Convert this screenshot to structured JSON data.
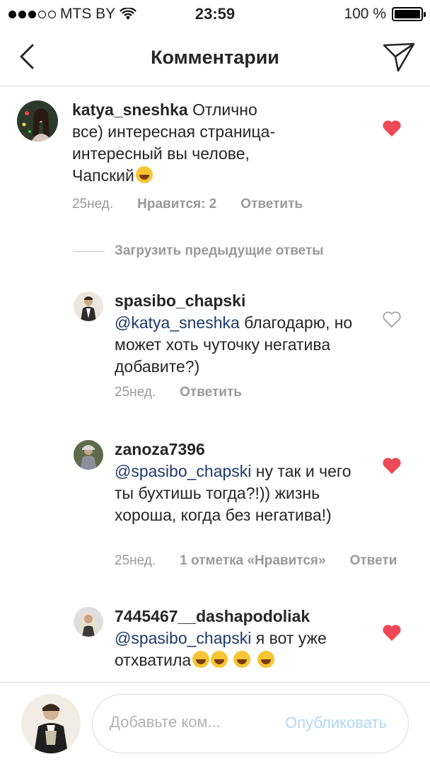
{
  "status_bar": {
    "carrier": "MTS BY",
    "time": "23:59",
    "battery": "100 %",
    "battery_level": 1.0
  },
  "nav": {
    "title": "Комментарии"
  },
  "comments": [
    {
      "username": "katya_sneshka",
      "text": "Отлично все) интересная страница- интересный вы челове, Чапский",
      "emoji": "grinning-face",
      "age": "25нед.",
      "likes": "Нравится: 2",
      "reply": "Ответить",
      "liked": true
    },
    {
      "username": "spasibo_chapski",
      "mention": "@katya_sneshka",
      "text": " благодарю, но может хоть чуточку негатива добавите?)",
      "age": "25нед.",
      "reply": "Ответить",
      "liked": false
    },
    {
      "username": "zanoza7396",
      "mention": "@spasibo_chapski",
      "text": " ну так и чего ты бухтишь тогда?!)) жизнь хороша, когда без негатива!)",
      "age": "25нед.",
      "likes": "1 отметка «Нравится»",
      "reply": "Ответи",
      "liked": true
    },
    {
      "username": "7445467__dashapodoliak",
      "mention": "@spasibo_chapski",
      "text": " я вот уже отхватила",
      "emoji": "tears-of-joy, tears-of-joy, winking-face, winking-face",
      "liked": true
    }
  ],
  "load_previous": "Загрузить предыдущие ответы",
  "composer": {
    "placeholder": "Добавьте ком...",
    "publish": "Опубликовать"
  },
  "colors": {
    "heart_active": "#ed4956",
    "mention": "#1c3a6b",
    "meta": "#999999",
    "publish_disabled": "#b2d7f5"
  }
}
